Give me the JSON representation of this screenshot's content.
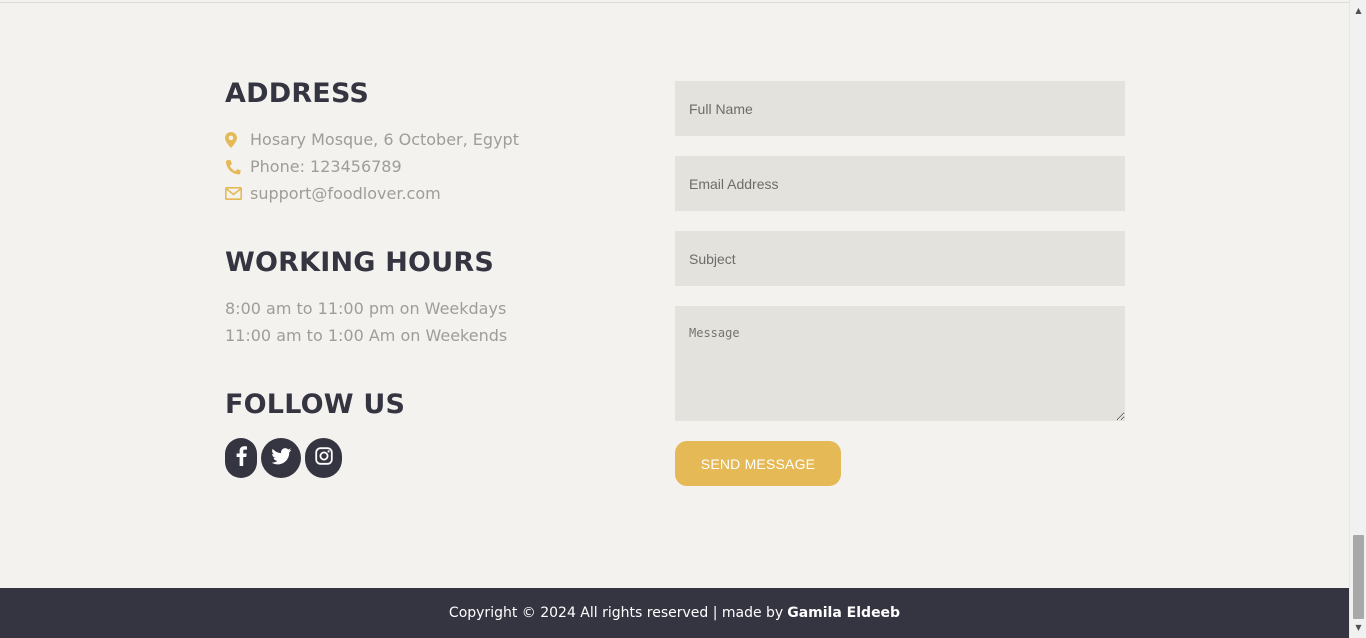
{
  "contact": {
    "address_title": "ADDRESS",
    "address": "Hosary Mosque, 6 October, Egypt",
    "phone": "Phone: 123456789",
    "email": "support@foodlover.com",
    "hours_title": "WORKING HOURS",
    "weekdays": "8:00 am to 11:00 pm on Weekdays",
    "weekends": "11:00 am to 1:00 Am on Weekends",
    "follow_title": "FOLLOW US",
    "socials": [
      {
        "icon": "facebook-icon"
      },
      {
        "icon": "twitter-icon"
      },
      {
        "icon": "instagram-icon"
      }
    ]
  },
  "form": {
    "name_placeholder": "Full Name",
    "email_placeholder": "Email Address",
    "subject_placeholder": "Subject",
    "message_placeholder": "Message",
    "send_label": "SEND MESSAGE"
  },
  "footer": {
    "copyright": "Copyright © 2024 All rights reserved | made by",
    "author": "Gamila Eldeeb"
  },
  "colors": {
    "accent": "#e4b956",
    "dark": "#353441",
    "background": "#f3f2ee",
    "field": "#e3e2dd"
  }
}
